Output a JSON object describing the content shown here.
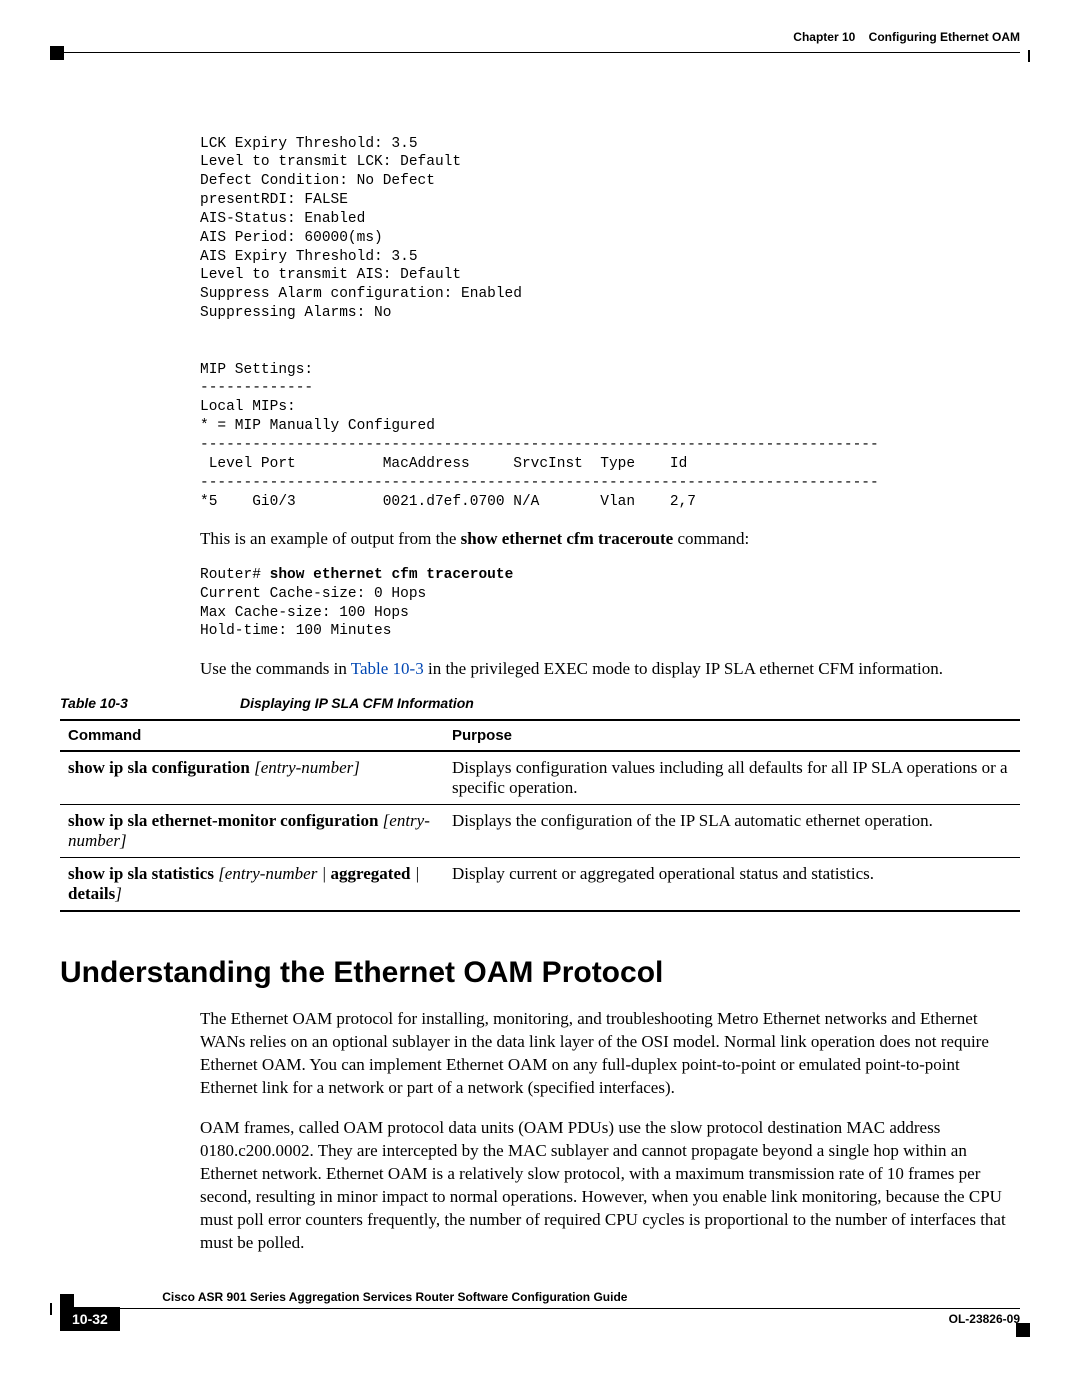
{
  "header": {
    "chapter_label": "Chapter 10",
    "chapter_title": "Configuring Ethernet OAM"
  },
  "pre_block_1": "LCK Expiry Threshold: 3.5\nLevel to transmit LCK: Default\nDefect Condition: No Defect\npresentRDI: FALSE\nAIS-Status: Enabled\nAIS Period: 60000(ms)\nAIS Expiry Threshold: 3.5\nLevel to transmit AIS: Default\nSuppress Alarm configuration: Enabled\nSuppressing Alarms: No\n\n\nMIP Settings:\n-------------\nLocal MIPs:\n* = MIP Manually Configured\n------------------------------------------------------------------------------\n Level Port          MacAddress     SrvcInst  Type    Id\n------------------------------------------------------------------------------\n*5    Gi0/3          0021.d7ef.0700 N/A       Vlan    2,7",
  "para_1": {
    "prefix": "This is an example of output from the ",
    "cmd": "show ethernet cfm traceroute",
    "suffix": " command:"
  },
  "pre_block_2_prompt": "Router# ",
  "pre_block_2_cmd": "show ethernet cfm traceroute",
  "pre_block_2_rest": "\nCurrent Cache-size: 0 Hops\nMax Cache-size: 100 Hops\nHold-time: 100 Minutes",
  "para_2": {
    "prefix": "Use the commands in ",
    "link": "Table 10-3",
    "suffix": " in the privileged EXEC mode to display IP SLA ethernet CFM information."
  },
  "table": {
    "number": "Table 10-3",
    "title": "Displaying IP SLA CFM Information",
    "headers": [
      "Command",
      "Purpose"
    ],
    "rows": [
      {
        "cmd_bold_1": "show ip sla configuration",
        "cmd_italic_1": " [entry-number]",
        "purpose": "Displays configuration values including all defaults for all IP SLA operations or a specific operation."
      },
      {
        "cmd_bold_1": "show ip sla ethernet-monitor configuration",
        "cmd_italic_1": " [entry-number]",
        "purpose": "Displays the configuration of the IP SLA automatic ethernet operation."
      },
      {
        "cmd_bold_1": "show ip sla statistics",
        "cmd_italic_1": " [entry-number | ",
        "cmd_bold_2": "aggregated",
        "cmd_italic_2": " | ",
        "cmd_bold_3": "details",
        "cmd_italic_3": "]",
        "purpose": "Display current or aggregated operational status and statistics."
      }
    ]
  },
  "heading": "Understanding the Ethernet OAM Protocol",
  "para_3": "The Ethernet OAM protocol for installing, monitoring, and troubleshooting Metro Ethernet networks and Ethernet WANs relies on an optional sublayer in the data link layer of the OSI model. Normal link operation does not require Ethernet OAM. You can implement Ethernet OAM on any full-duplex point-to-point or emulated point-to-point Ethernet link for a network or part of a network (specified interfaces).",
  "para_4": "OAM frames, called OAM protocol data units (OAM PDUs) use the slow protocol destination MAC address 0180.c200.0002. They are intercepted by the MAC sublayer and cannot propagate beyond a single hop within an Ethernet network. Ethernet OAM is a relatively slow protocol, with a maximum transmission rate of 10 frames per second, resulting in minor impact to normal operations. However, when you enable link monitoring, because the CPU must poll error counters frequently, the number of required CPU cycles is proportional to the number of interfaces that must be polled.",
  "footer": {
    "guide_title": "Cisco ASR 901 Series Aggregation Services Router Software Configuration Guide",
    "page_number": "10-32",
    "doc_id": "OL-23826-09"
  }
}
